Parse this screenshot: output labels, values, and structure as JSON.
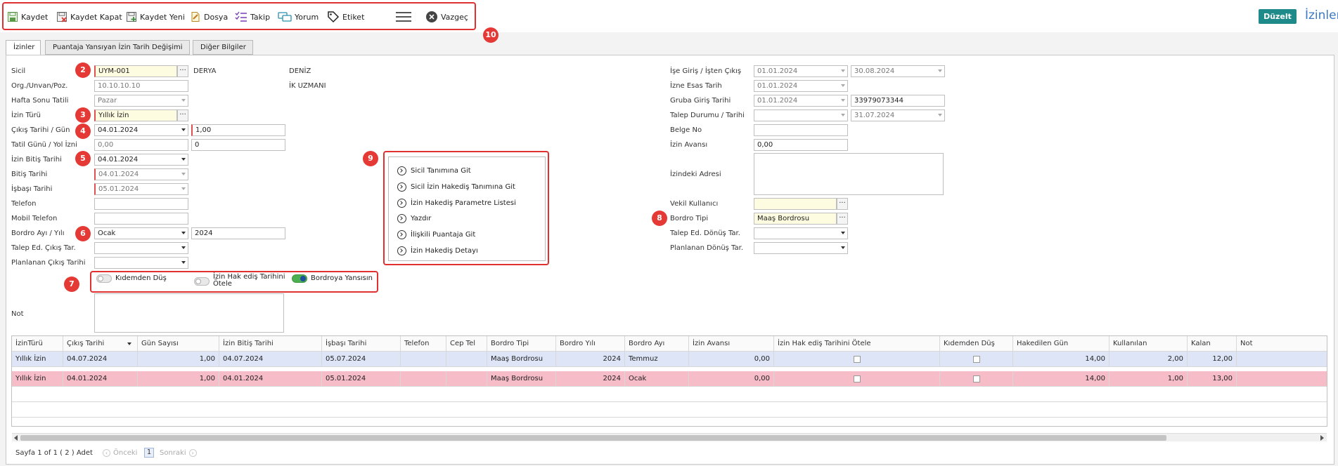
{
  "toolbar": {
    "buttons": [
      {
        "label": "Kaydet",
        "icon": "save-icon"
      },
      {
        "label": "Kaydet Kapat",
        "icon": "save-close-icon"
      },
      {
        "label": "Kaydet Yeni",
        "icon": "save-new-icon"
      },
      {
        "label": "Dosya",
        "icon": "file-icon"
      },
      {
        "label": "Takip",
        "icon": "checklist-icon"
      },
      {
        "label": "Yorum",
        "icon": "comment-icon"
      },
      {
        "label": "Etiket",
        "icon": "tag-icon"
      },
      {
        "label": "Vazgeç",
        "icon": "close-circle-icon"
      }
    ],
    "edit_label": "Düzelt",
    "page_title": "İzinler"
  },
  "tabs": [
    {
      "label": "İzinler",
      "active": true
    },
    {
      "label": "Puantaja Yansıyan İzin Tarih Değişimi",
      "active": false
    },
    {
      "label": "Diğer Bilgiler",
      "active": false
    }
  ],
  "badges": [
    "2",
    "3",
    "4",
    "5",
    "6",
    "7",
    "8",
    "9",
    "10"
  ],
  "left_form": {
    "sicil_label": "Sicil",
    "sicil_value": "UYM-001",
    "first_name": "DERYA",
    "last_name": "DENİZ",
    "org_label": "Org./Unvan/Poz.",
    "org_value": "10.10.10.10",
    "unvan": "İK UZMANI",
    "hafta_label": "Hafta Sonu Tatili",
    "hafta_value": "Pazar",
    "izin_turu_label": "İzin Türü",
    "izin_turu_value": "Yıllık İzin",
    "cikis_label": "Çıkış Tarihi / Gün",
    "cikis_date": "04.01.2024",
    "cikis_gun": "1,00",
    "tatil_label": "Tatil Günü / Yol İzni",
    "tatil_value": "0,00",
    "yol_value": "0",
    "izin_bitis_label": "İzin Bitiş Tarihi",
    "izin_bitis_value": "04.01.2024",
    "bitis_label": "Bitiş Tarihi",
    "bitis_value": "04.01.2024",
    "isbasi_label": "İşbaşı Tarihi",
    "isbasi_value": "05.01.2024",
    "telefon_label": "Telefon",
    "mobil_label": "Mobil Telefon",
    "bordro_label": "Bordro Ayı / Yılı",
    "bordro_ay": "Ocak",
    "bordro_yil": "2024",
    "talep_cikis_label": "Talep Ed. Çıkış Tar.",
    "planlanan_cikis_label": "Planlanan Çıkış Tarihi",
    "not_label": "Not"
  },
  "toggles": [
    {
      "label": "Kıdemden Düş",
      "on": false
    },
    {
      "label": "İzin Hak ediş Tarihini Ötele",
      "on": false
    },
    {
      "label": "Bordroya Yansısın",
      "on": true
    }
  ],
  "context_menu": [
    "Sicil Tanımına Git",
    "Sicil İzin Hakediş Tanımına Git",
    "İzin Hakediş Parametre Listesi",
    "Yazdır",
    "İlişkili Puantaja Git",
    "İzin Hakediş Detayı"
  ],
  "right_form": {
    "ise_giris_label": "İşe Giriş / İşten Çıkış",
    "ise_giris": "01.01.2024",
    "isten_cikis": "30.08.2024",
    "izne_esas_label": "İzne Esas Tarih",
    "izne_esas": "01.01.2024",
    "gruba_label": "Gruba Giriş Tarihi",
    "gruba_giris": "01.01.2024",
    "tc_no": "33979073344",
    "talep_durumu_label": "Talep Durumu / Tarihi",
    "talep_tarihi": "31.07.2024",
    "belge_label": "Belge No",
    "avans_label": "İzin Avansı",
    "avans_value": "0,00",
    "adres_label": "İzindeki Adresi",
    "vekil_label": "Vekil Kullanıcı",
    "bordro_tipi_label": "Bordro Tipi",
    "bordro_tipi": "Maaş Bordrosu",
    "talep_donus_label": "Talep Ed. Dönüş Tar.",
    "planlanan_donus_label": "Planlanan Dönüş Tar."
  },
  "grid": {
    "columns": [
      "İzinTürü",
      "Çıkış Tarihi",
      "Gün Sayısı",
      "İzin Bitiş Tarihi",
      "İşbaşı Tarihi",
      "Telefon",
      "Cep Tel",
      "Bordro Tipi",
      "Bordro Yılı",
      "Bordro Ayı",
      "İzin Avansı",
      "İzin Hak ediş Tarihini Ötele",
      "Kıdemden Düş",
      "Hakedilen Gün",
      "Kullanılan",
      "Kalan",
      "Not"
    ],
    "rows": [
      [
        "Yıllık İzin",
        "04.07.2024",
        "1,00",
        "04.07.2024",
        "05.07.2024",
        "",
        "",
        "Maaş Bordrosu",
        "2024",
        "Temmuz",
        "0,00",
        "",
        "",
        "14,00",
        "2,00",
        "12,00",
        ""
      ],
      [
        "Yıllık İzin",
        "04.01.2024",
        "1,00",
        "04.01.2024",
        "05.01.2024",
        "",
        "",
        "Maaş Bordrosu",
        "2024",
        "Ocak",
        "0,00",
        "",
        "",
        "14,00",
        "1,00",
        "13,00",
        ""
      ]
    ],
    "row_colors": [
      "#dde5f7",
      "#f6bcc8"
    ]
  },
  "pager": {
    "info": "Sayfa 1 of 1 ( 2 ) Adet",
    "prev": "Önceki",
    "page": "1",
    "next": "Sonraki"
  }
}
